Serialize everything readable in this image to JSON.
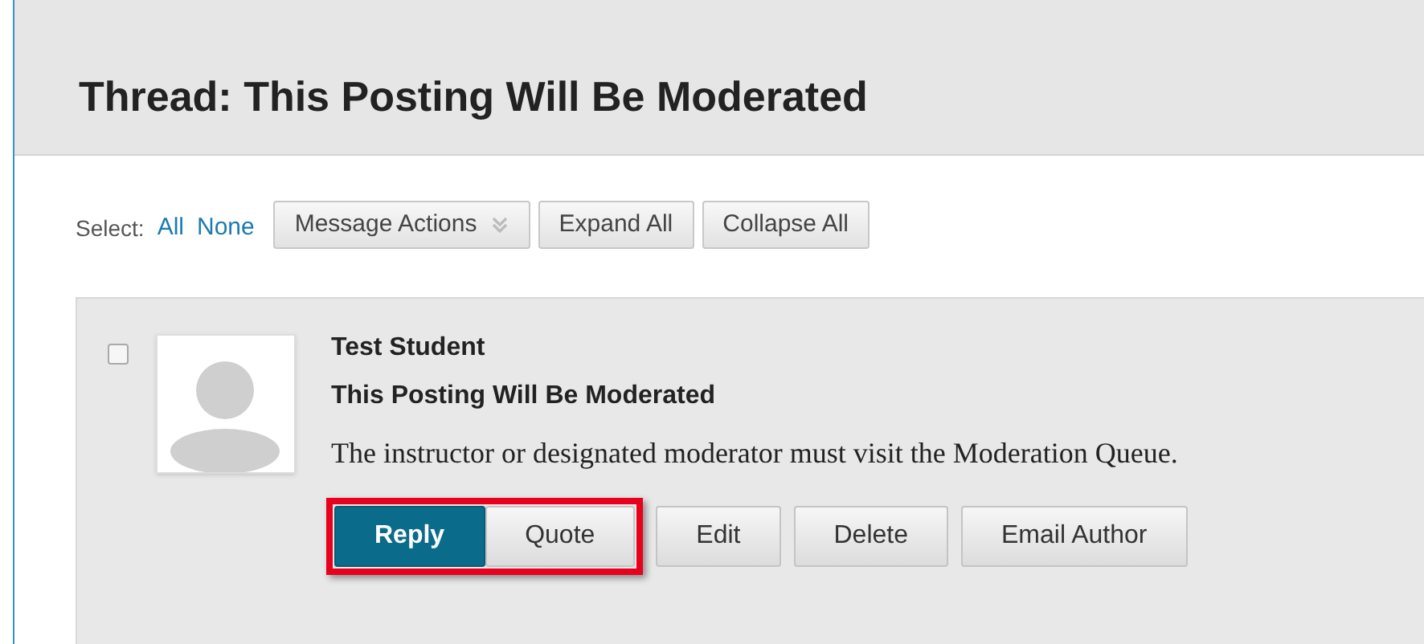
{
  "thread_title": "Thread: This Posting Will Be Moderated",
  "toolbar": {
    "select_label": "Select:",
    "select_links": [
      "All",
      "None"
    ],
    "buttons": [
      {
        "label": "Message Actions",
        "kind": "dropdown"
      },
      {
        "label": "Expand All",
        "kind": "plain"
      },
      {
        "label": "Collapse All",
        "kind": "plain"
      }
    ]
  },
  "post": {
    "checked": false,
    "author": "Test Student",
    "subject": "This Posting Will Be Moderated",
    "body": "The instructor or designated moderator must visit the Moderation Queue.",
    "highlighted_actions": [
      {
        "label": "Reply",
        "kind": "primary"
      },
      {
        "label": "Quote",
        "kind": "plain"
      }
    ],
    "actions": [
      {
        "label": "Edit",
        "kind": "plain"
      },
      {
        "label": "Delete",
        "kind": "plain"
      },
      {
        "label": "Email Author",
        "kind": "plain"
      }
    ]
  }
}
